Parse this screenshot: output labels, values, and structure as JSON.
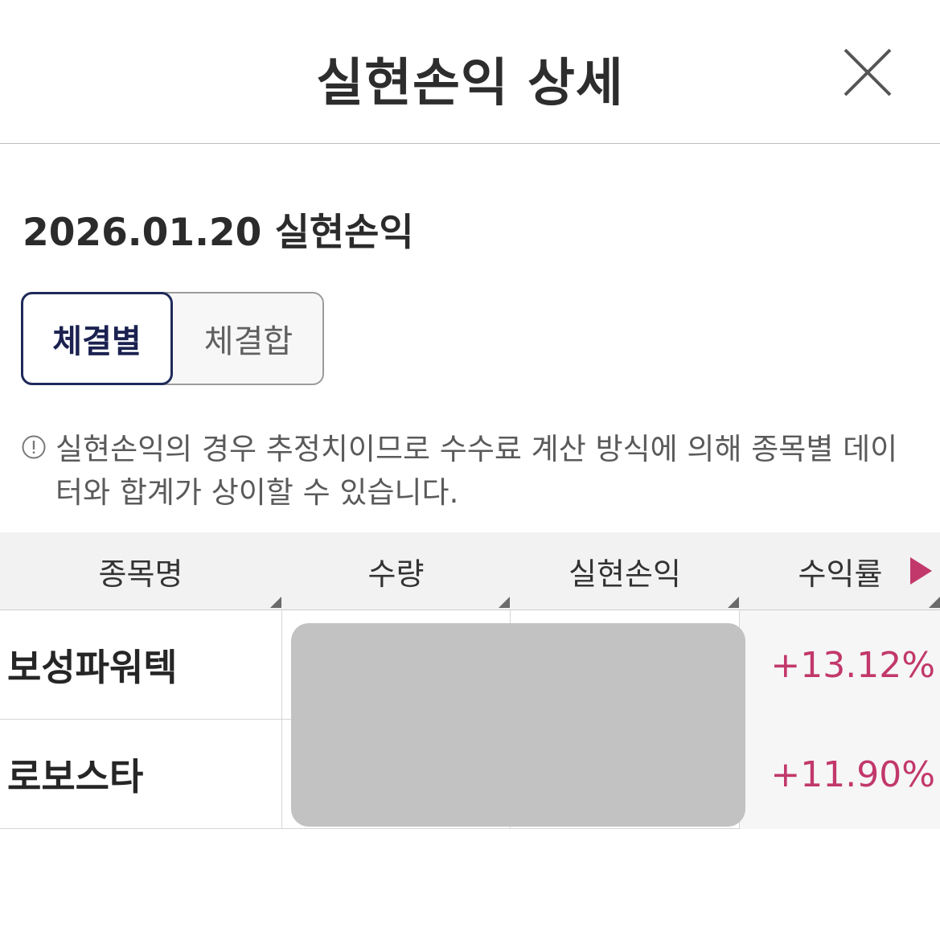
{
  "header": {
    "title": "실현손익 상세",
    "close_icon": "close-icon"
  },
  "summary": {
    "date_title": "2026.01.20 실현손익"
  },
  "segment": {
    "options": [
      "체결별",
      "체결합"
    ],
    "selected": "체결별"
  },
  "notice": {
    "icon": "info-circle-icon",
    "text": "실현손익의 경우 추정치이므로 수수료 계산 방식에 의해 종목별 데이터와 합계가 상이할 수 있습니다."
  },
  "table": {
    "columns": [
      "종목명",
      "수량",
      "실현손익",
      "수익률"
    ],
    "scroll_icon": "scroll-right-arrow-icon",
    "rows": [
      {
        "name": "보성파워텍",
        "rate": "+13.12%"
      },
      {
        "name": "로보스타",
        "rate": "+11.90%"
      }
    ]
  },
  "colors": {
    "accent_navy": "#1f2a5a",
    "profit_pink": "#c2386b",
    "redaction_gray": "#c2c2c2"
  }
}
